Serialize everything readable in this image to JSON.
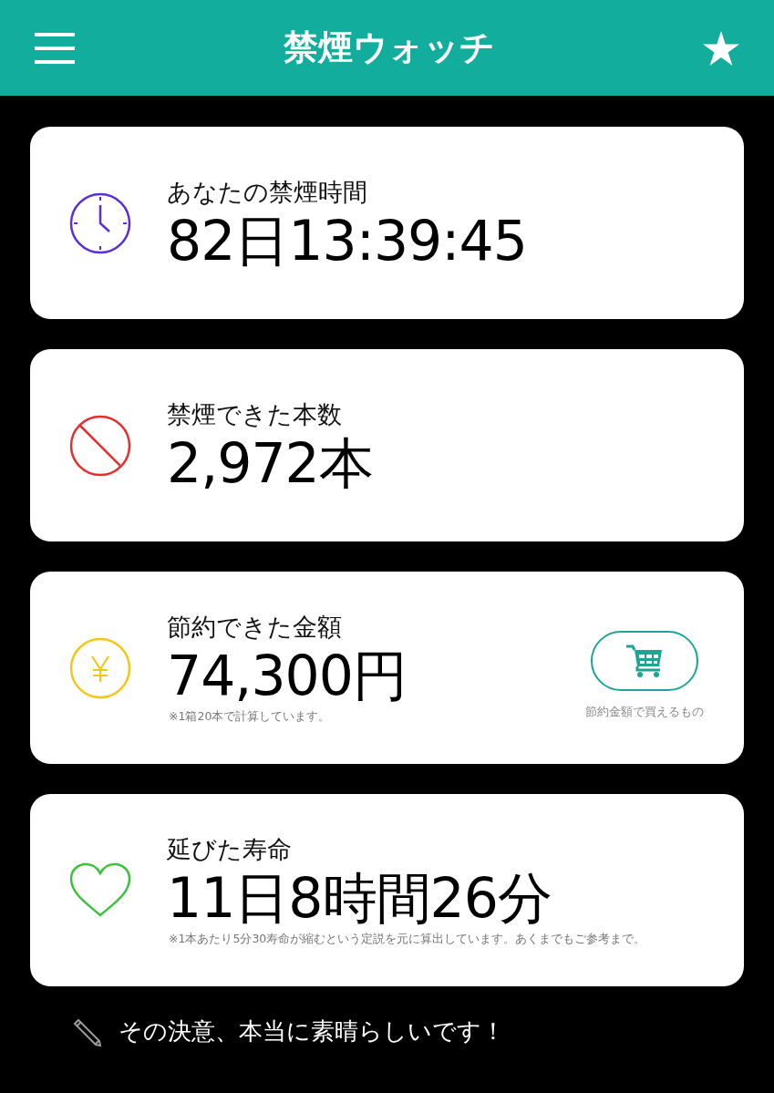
{
  "header": {
    "title": "禁煙ウォッチ"
  },
  "cards": [
    {
      "kind": "clock",
      "label": "あなたの禁煙時間",
      "value": "82日13:39:45"
    },
    {
      "kind": "prohibit",
      "label": "禁煙できた本数",
      "value": "2,972本"
    },
    {
      "kind": "yen",
      "label": "節約できた金額",
      "value": "74,300円",
      "note": "※1箱20本で計算しています。",
      "action": {
        "caption": "節約金額で買えるもの"
      }
    },
    {
      "kind": "heart",
      "label": "延びた寿命",
      "value": "11日8時間26分",
      "note": "※1本あたり5分30寿命が縮むという定説を元に算出しています。あくまでもご参考まで。"
    }
  ],
  "footer": {
    "message": "その決意、本当に素晴らしいです！"
  }
}
